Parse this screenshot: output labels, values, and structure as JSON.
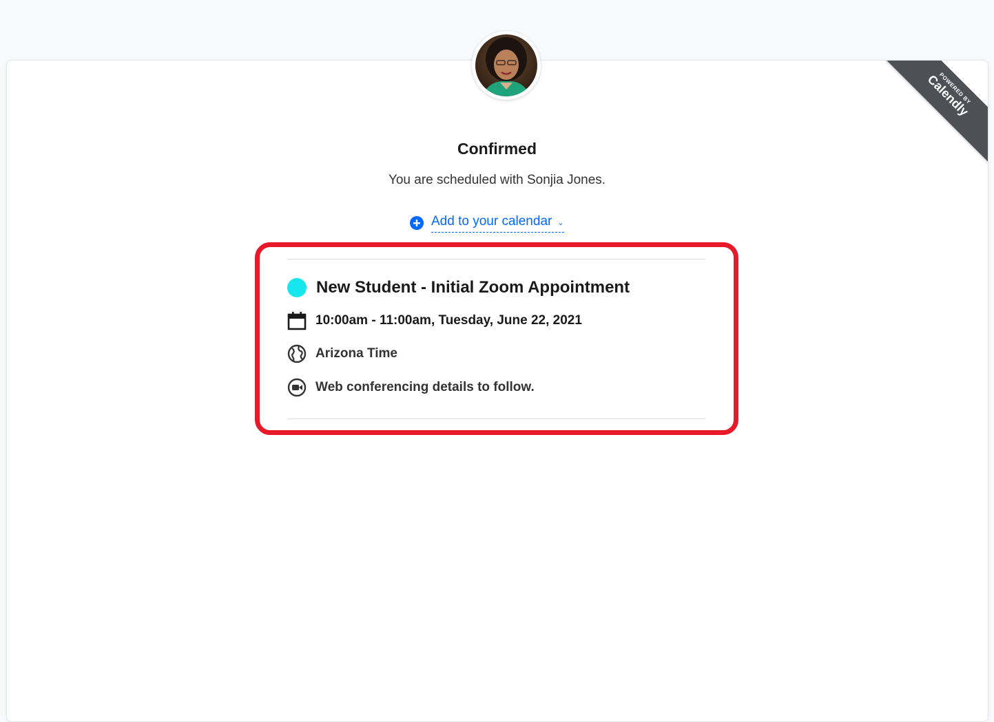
{
  "brand_ribbon": {
    "powered_by": "POWERED BY",
    "brand": "Calendly",
    "color": "#4d5055"
  },
  "header": {
    "title": "Confirmed",
    "subtitle": "You are scheduled with Sonjia Jones."
  },
  "add_to_calendar": {
    "label": "Add to your calendar",
    "icon": "plus-circle-icon",
    "chevron": "chevron-down-icon",
    "color": "#0069ff"
  },
  "event": {
    "name": "New Student - Initial Zoom Appointment",
    "color_dot": "#17e6ef",
    "time": "10:00am - 11:00am, Tuesday, June 22, 2021",
    "timezone": "Arizona Time",
    "conferencing": "Web conferencing details to follow."
  },
  "icons": {
    "calendar": "calendar-icon",
    "globe": "globe-icon",
    "video": "video-camera-icon"
  },
  "highlight_color": "#e7192b"
}
